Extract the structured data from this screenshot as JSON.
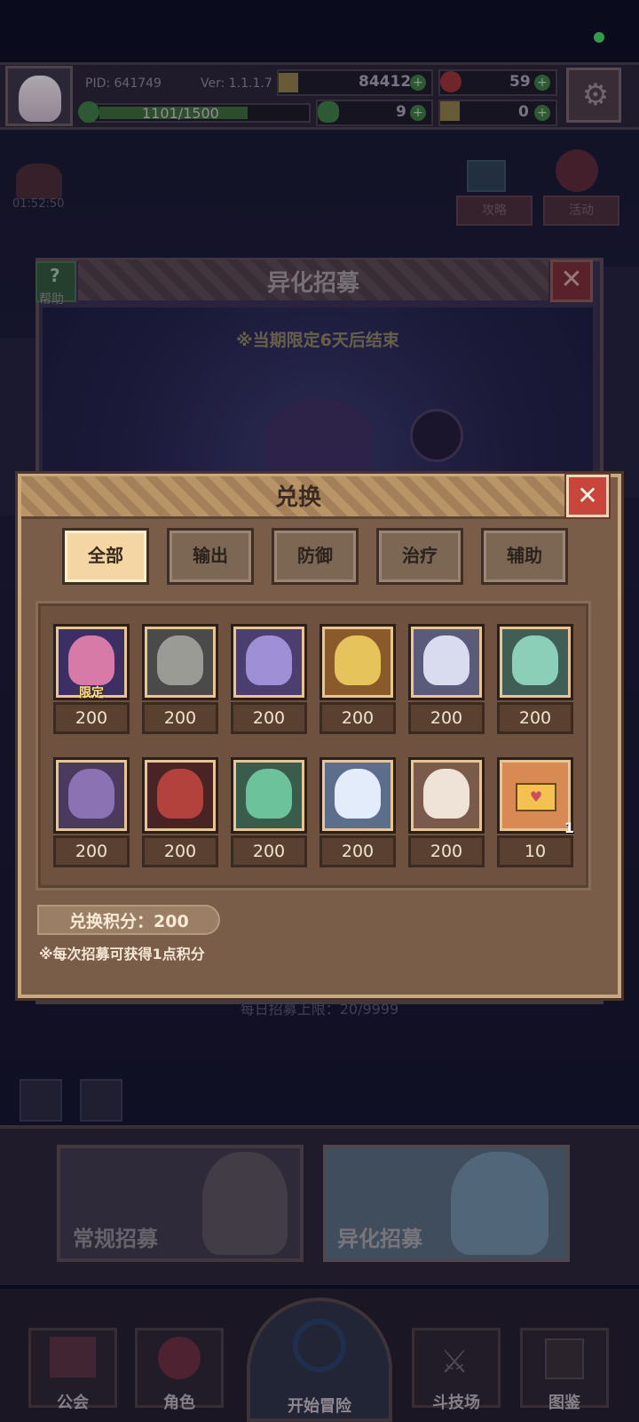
{
  "top_bar": {
    "pid": "PID: 641749",
    "version": "Ver: 1.1.1.7",
    "gold": "84412",
    "apples": "59",
    "xp": "1101/1500",
    "xp_fraction": 0.734,
    "clovers": "9",
    "energy": "0"
  },
  "background": {
    "timer": "01:52:50",
    "guide_btn": "攻略",
    "event_btn": "活动",
    "recruit_title": "异化招募",
    "help_label": "帮助",
    "notice": "※当期限定6天后结束",
    "daily_limit": "每日招募上限：20/9999",
    "normal_recruit": "常规招募",
    "alien_recruit": "异化招募"
  },
  "nav": {
    "guild": "公会",
    "character": "角色",
    "adventure": "开始冒险",
    "arena": "斗技场",
    "codex": "图鉴"
  },
  "dialog": {
    "title": "兑换",
    "tabs": [
      "全部",
      "输出",
      "防御",
      "治疗",
      "辅助"
    ],
    "active_tab": "全部",
    "items_row1": [
      {
        "price": "200",
        "tag": "限定"
      },
      {
        "price": "200"
      },
      {
        "price": "200"
      },
      {
        "price": "200"
      },
      {
        "price": "200"
      },
      {
        "price": "200"
      }
    ],
    "items_row2": [
      {
        "price": "200"
      },
      {
        "price": "200"
      },
      {
        "price": "200"
      },
      {
        "price": "200"
      },
      {
        "price": "200"
      },
      {
        "price": "10",
        "count": "1"
      }
    ],
    "points": "兑换积分：200",
    "note": "※每次招募可获得1点积分"
  },
  "colors": {
    "dialog_bg": "#7a5d48",
    "active_tab": "#f3d6a3",
    "close_red": "#c8453c",
    "limited_tag": "#ffe27a"
  }
}
